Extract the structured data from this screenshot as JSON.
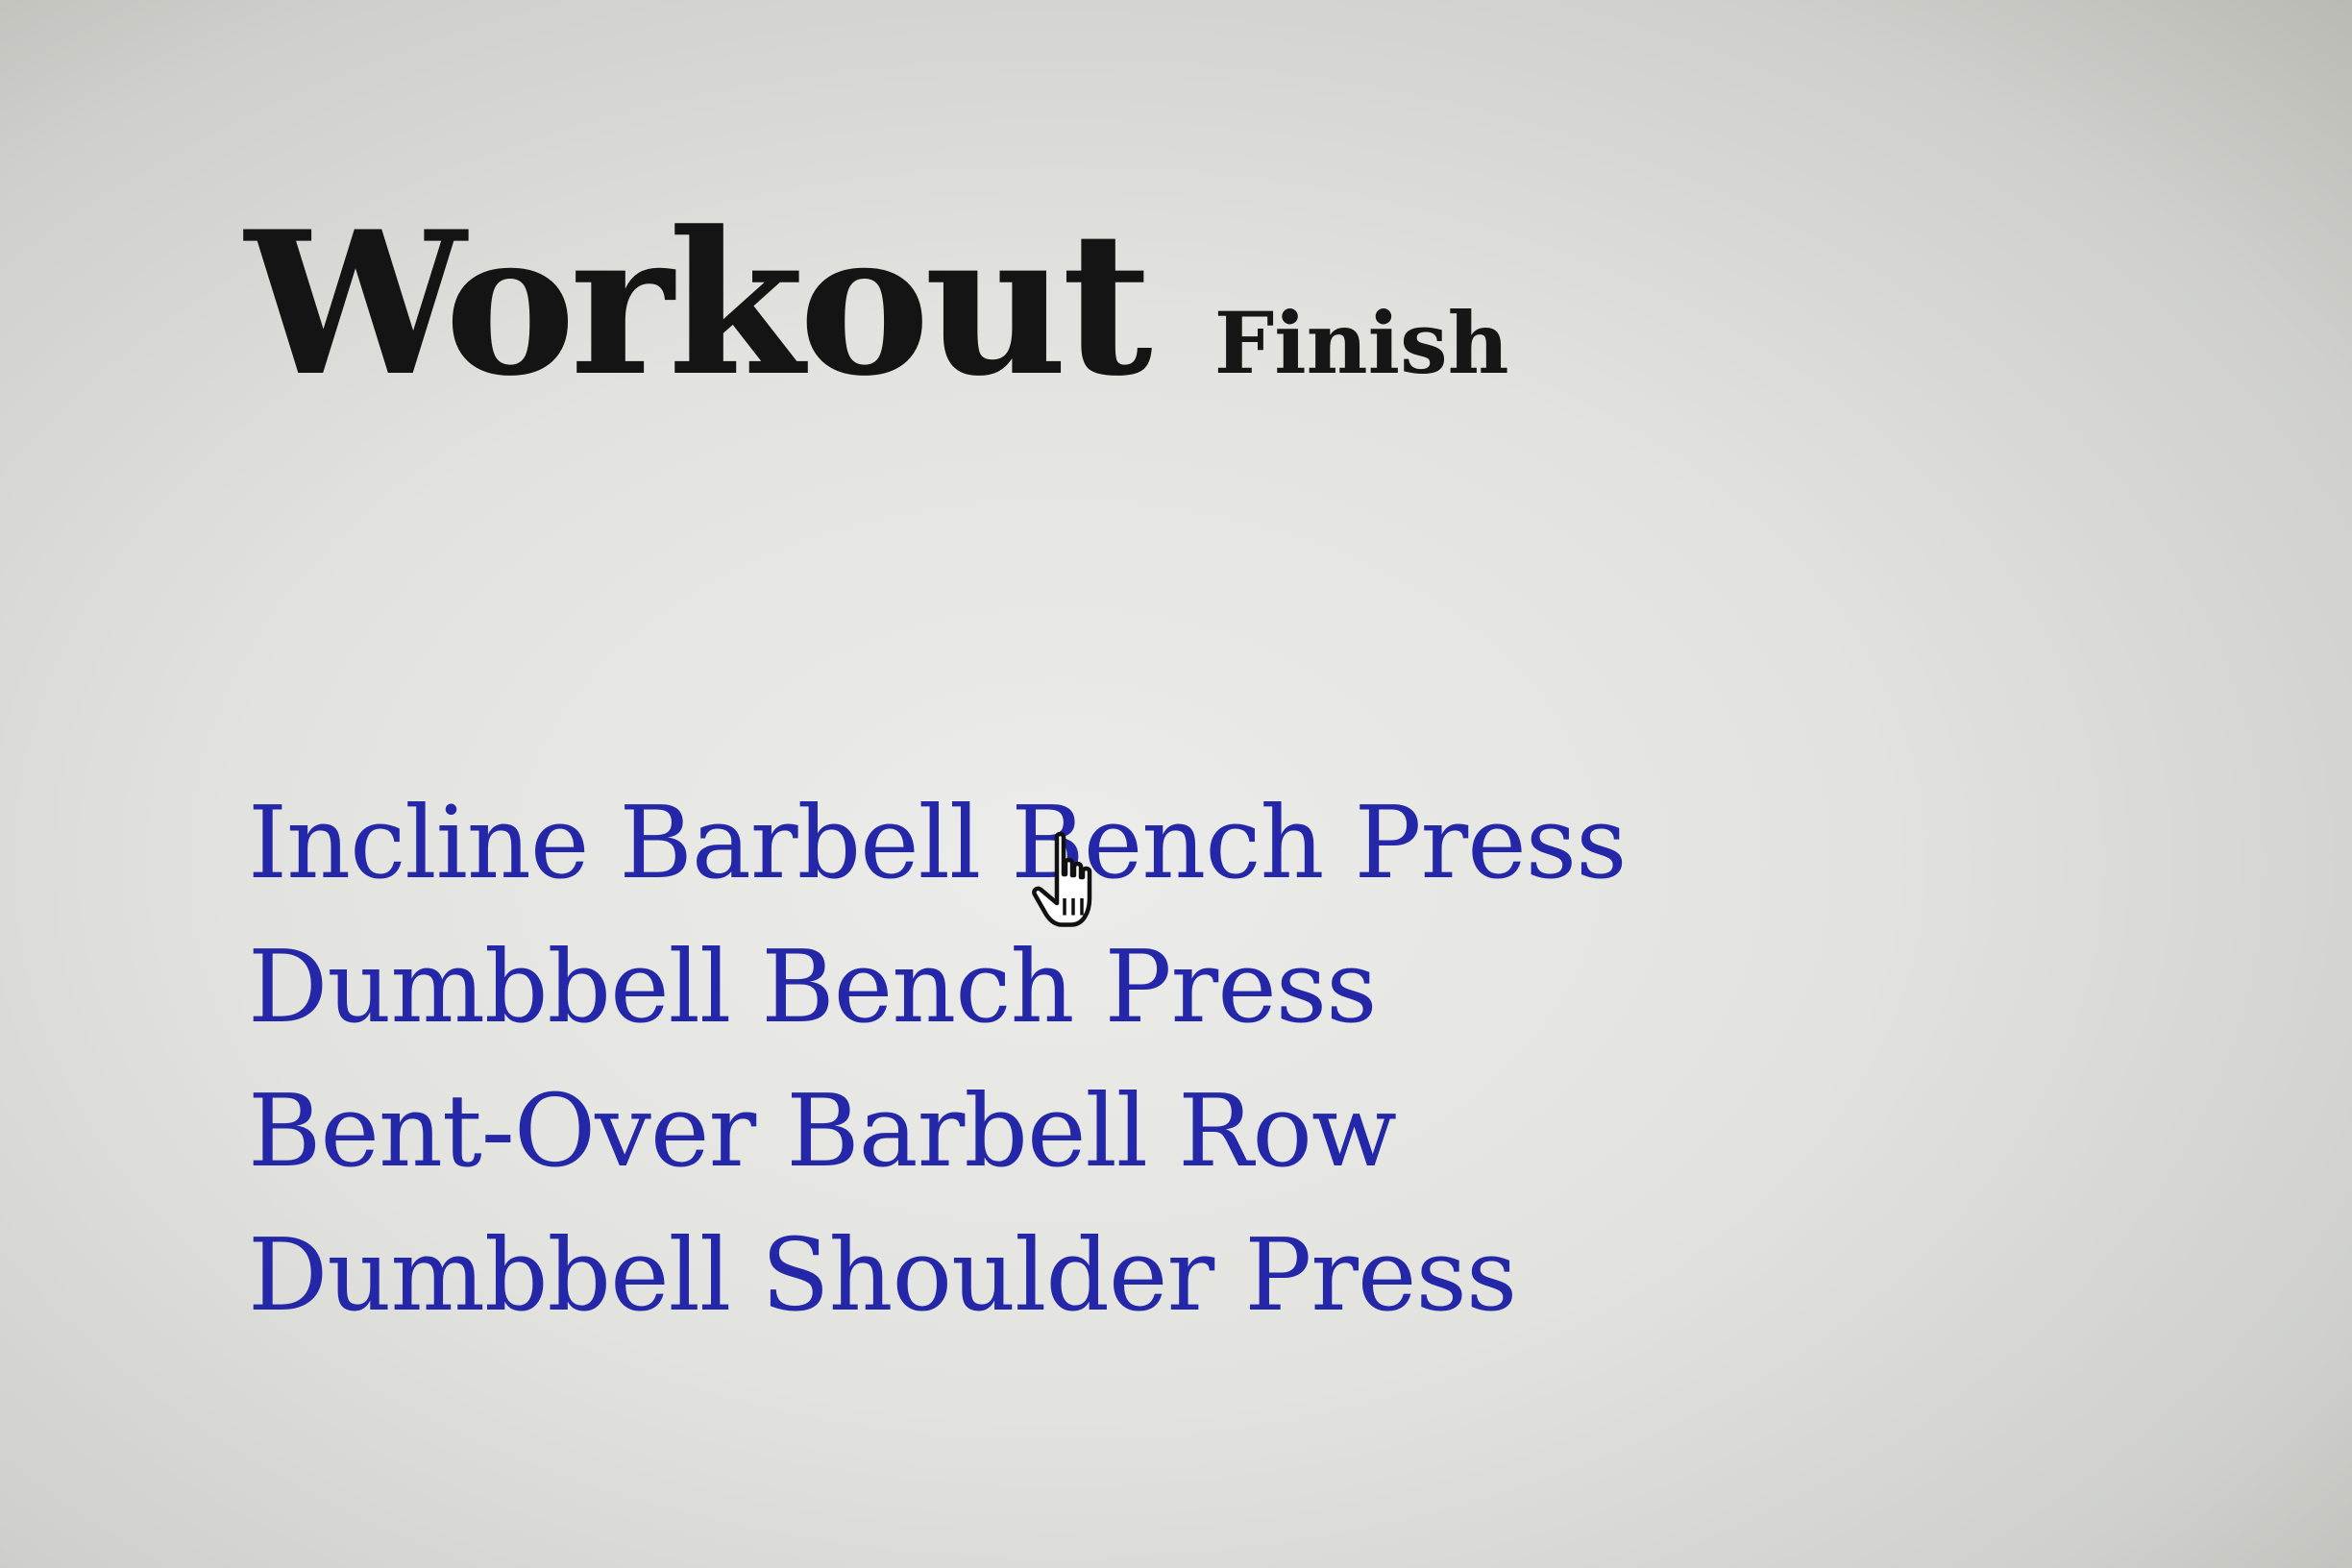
{
  "header": {
    "title": "Workout",
    "finish_label": "Finish"
  },
  "exercises": [
    {
      "label": "Incline Barbell Bench Press"
    },
    {
      "label": "Dumbbell Bench Press"
    },
    {
      "label": "Bent-Over Barbell Row"
    },
    {
      "label": "Dumbbell Shoulder Press"
    }
  ],
  "cursor": {
    "icon": "hand-pointer-icon"
  },
  "colors": {
    "link": "#2427a8",
    "title": "#141414",
    "background": "#e2e2de"
  }
}
